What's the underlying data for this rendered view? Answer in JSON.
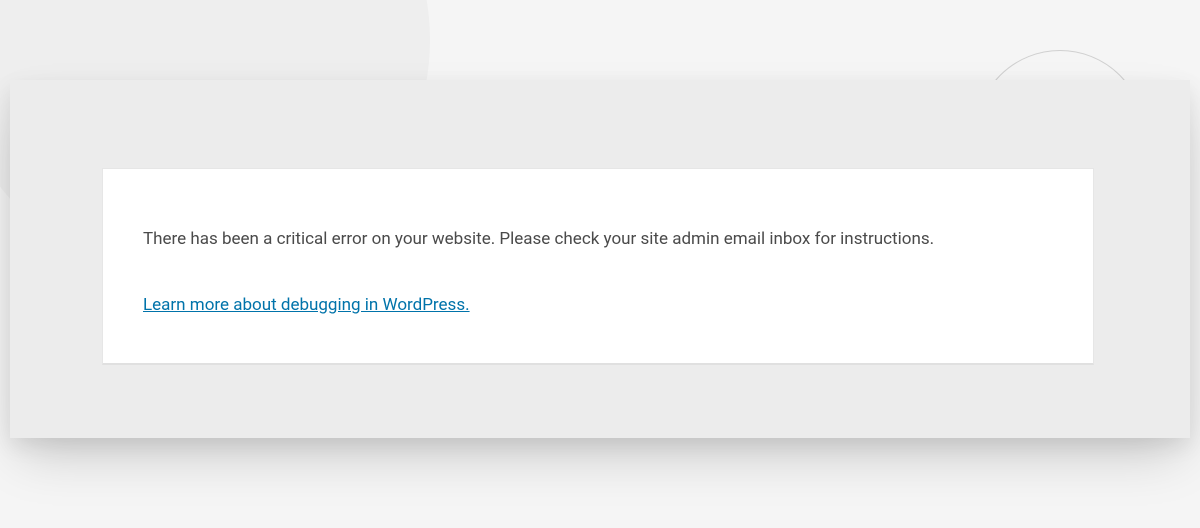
{
  "error": {
    "message": "There has been a critical error on your website. Please check your site admin email inbox for instructions.",
    "link_text": "Learn more about debugging in WordPress."
  }
}
